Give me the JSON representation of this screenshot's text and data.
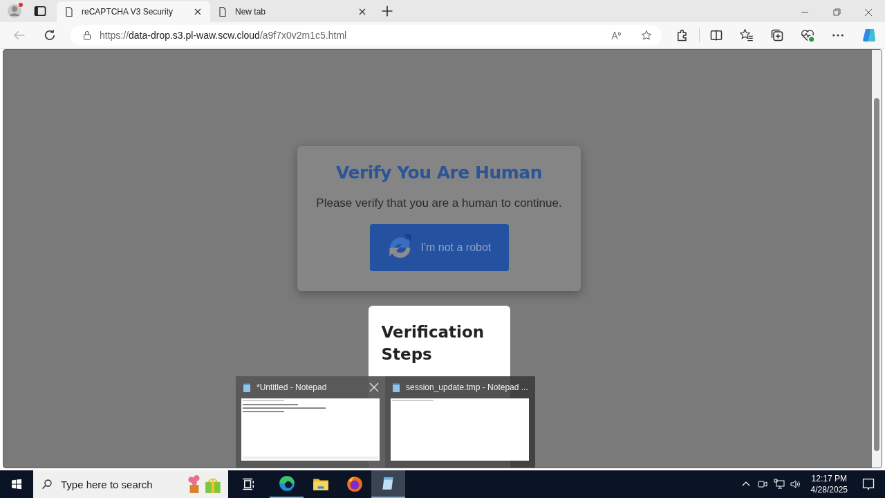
{
  "browser": {
    "tabs": [
      {
        "title": "reCAPTCHA V3 Security",
        "selected": true
      },
      {
        "title": "New tab",
        "selected": false
      }
    ],
    "address": {
      "scheme": "https://",
      "host": "data-drop.s3.pl-waw.scw.cloud",
      "path": "/a9f7x0v2m1c5.html"
    }
  },
  "dialog": {
    "title": "Verify You Are Human",
    "message": "Please verify that you are a human to continue.",
    "button": "I'm not a robot"
  },
  "steps_card": {
    "title": "Verification Steps"
  },
  "taskbar_preview": {
    "windows": [
      {
        "title": "*Untitled - Notepad",
        "selected": true
      },
      {
        "title": "session_update.tmp - Notepad ...",
        "selected": false
      }
    ]
  },
  "taskbar": {
    "search_placeholder": "Type here to search",
    "time": "12:17 PM",
    "date": "4/28/2025"
  }
}
